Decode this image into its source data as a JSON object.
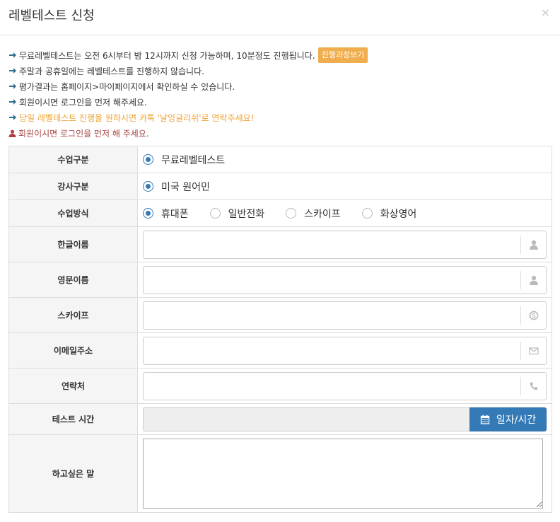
{
  "header": {
    "title": "레벨테스트 신청",
    "close_label": "×"
  },
  "process_button": "진행과정보기",
  "notices": [
    {
      "text": "무료레벨테스트는 오전 6시부터 밤 12시까지 신청 가능하며, 10분정도 진행됩니다.",
      "color": "#333333"
    },
    {
      "text": "주말과 공휴일에는 레벨테스트를 진행하지 않습니다.",
      "color": "#333333"
    },
    {
      "text": "평가결과는 홈페이지>마이페이지에서 확인하실 수 있습니다.",
      "color": "#333333"
    },
    {
      "text": "회원이시면 로그인을 먼저 해주세요.",
      "color": "#333333"
    },
    {
      "text": "당일 레벨테스트 진행을 원하시면 카톡 '날잉글리쉬'로 연락주세요!",
      "color": "#f0a030"
    },
    {
      "text": "회원이시면 로그인을 먼저 해 주세요.",
      "color": "#a94442"
    }
  ],
  "form": {
    "class_type": {
      "label": "수업구분",
      "options": [
        "무료레벨테스트"
      ],
      "selected": 0
    },
    "teacher_type": {
      "label": "강사구분",
      "options": [
        "미국 원어민"
      ],
      "selected": 0
    },
    "class_method": {
      "label": "수업방식",
      "options": [
        "휴대폰",
        "일반전화",
        "스카이프",
        "화상영어"
      ],
      "selected": 0
    },
    "korean_name": {
      "label": "한글이름",
      "value": "",
      "placeholder": "",
      "icon": "user-icon"
    },
    "english_name": {
      "label": "영문이름",
      "value": "",
      "placeholder": "",
      "icon": "user-icon"
    },
    "skype": {
      "label": "스카이프",
      "value": "",
      "placeholder": "",
      "icon": "skype-icon"
    },
    "email": {
      "label": "이메일주소",
      "value": "",
      "placeholder": "",
      "icon": "envelope-icon"
    },
    "phone": {
      "label": "연락처",
      "value": "",
      "placeholder": "",
      "icon": "phone-icon"
    },
    "test_time": {
      "label": "테스트 시간",
      "value": "",
      "button_label": "일자/시간",
      "icon": "calendar-icon"
    },
    "message": {
      "label": "하고싶은 말",
      "value": ""
    }
  },
  "colors": {
    "primary": "#337ab7",
    "warning": "#f0ad4e",
    "arrow": "#31708f",
    "danger": "#a94442"
  }
}
